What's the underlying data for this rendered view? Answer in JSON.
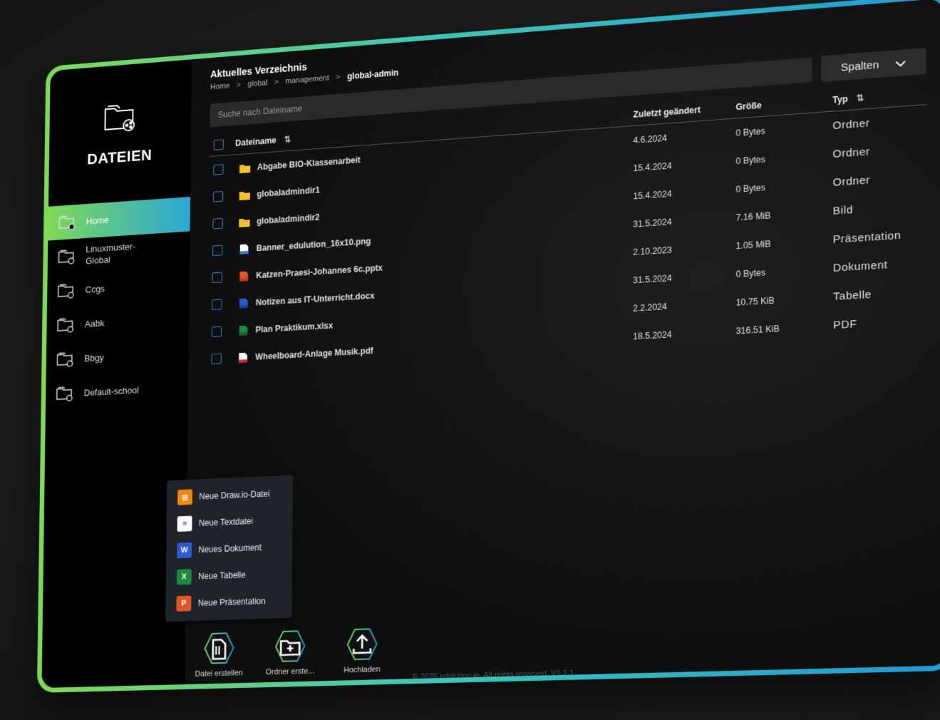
{
  "sidebar": {
    "title": "DATEIEN",
    "logo_icon": "folder-share-icon",
    "items": [
      {
        "label": "Home",
        "active": true
      },
      {
        "label": "Linuxmuster-\nGlobal",
        "active": false
      },
      {
        "label": "Ccgs",
        "active": false
      },
      {
        "label": "Aabk",
        "active": false
      },
      {
        "label": "Bbgy",
        "active": false
      },
      {
        "label": "Default-school",
        "active": false
      }
    ]
  },
  "header": {
    "title": "Aktuelles Verzeichnis",
    "breadcrumb": [
      "Home",
      "global",
      "management",
      "global-admin"
    ],
    "separator": ">"
  },
  "search": {
    "placeholder": "Suche nach Dateiname"
  },
  "columns_button": {
    "label": "Spalten"
  },
  "table": {
    "headers": {
      "name": "Dateiname",
      "modified": "Zuletzt geändert",
      "size": "Größe",
      "type": "Typ"
    },
    "sort_icon": "⇅",
    "rows": [
      {
        "name": "Abgabe BIO-Klassenarbeit",
        "modified": "4.6.2024",
        "size": "0 Bytes",
        "type": "Ordner",
        "icon": "folder"
      },
      {
        "name": "globaladmindir1",
        "modified": "15.4.2024",
        "size": "0 Bytes",
        "type": "Ordner",
        "icon": "folder"
      },
      {
        "name": "globaladmindir2",
        "modified": "15.4.2024",
        "size": "0 Bytes",
        "type": "Ordner",
        "icon": "folder"
      },
      {
        "name": "Banner_edulution_16x10.png",
        "modified": "31.5.2024",
        "size": "7.16 MiB",
        "type": "Bild",
        "icon": "image"
      },
      {
        "name": "Katzen-Praesi-Johannes 6c.pptx",
        "modified": "2.10.2023",
        "size": "1.05 MiB",
        "type": "Präsentation",
        "icon": "pptx"
      },
      {
        "name": "Notizen aus IT-Unterricht.docx",
        "modified": "31.5.2024",
        "size": "0 Bytes",
        "type": "Dokument",
        "icon": "docx"
      },
      {
        "name": "Plan Praktikum.xlsx",
        "modified": "2.2.2024",
        "size": "10.75 KiB",
        "type": "Tabelle",
        "icon": "xlsx"
      },
      {
        "name": "Wheelboard-Anlage Musik.pdf",
        "modified": "18.5.2024",
        "size": "316.51 KiB",
        "type": "PDF",
        "icon": "pdf"
      }
    ]
  },
  "create_menu": {
    "items": [
      {
        "label": "Neue Draw.io-Datei",
        "icon": "drawio-icon",
        "color": "#f08705",
        "glyph": "⊞"
      },
      {
        "label": "Neue Textdatei",
        "icon": "text-file-icon",
        "color": "#ffffff",
        "glyph": "≡"
      },
      {
        "label": "Neues Dokument",
        "icon": "word-icon",
        "color": "#2b5cd6",
        "glyph": "W"
      },
      {
        "label": "Neue Tabelle",
        "icon": "excel-icon",
        "color": "#1f8a3c",
        "glyph": "X"
      },
      {
        "label": "Neue Präsentation",
        "icon": "powerpoint-icon",
        "color": "#e0552a",
        "glyph": "P"
      }
    ]
  },
  "actions": [
    {
      "label": "Datei erstellen",
      "icon": "file-create-icon"
    },
    {
      "label": "Ordner erste...",
      "icon": "folder-create-icon"
    },
    {
      "label": "Hochladen",
      "icon": "upload-icon"
    }
  ],
  "footer": {
    "text": "© 2025 edulution.io. All rights reserved. V1.2.1"
  },
  "colors": {
    "accent_green": "#7ed957",
    "accent_blue": "#1f9ad6",
    "folder": "#f6c12b",
    "checkbox": "#3b86c9"
  }
}
